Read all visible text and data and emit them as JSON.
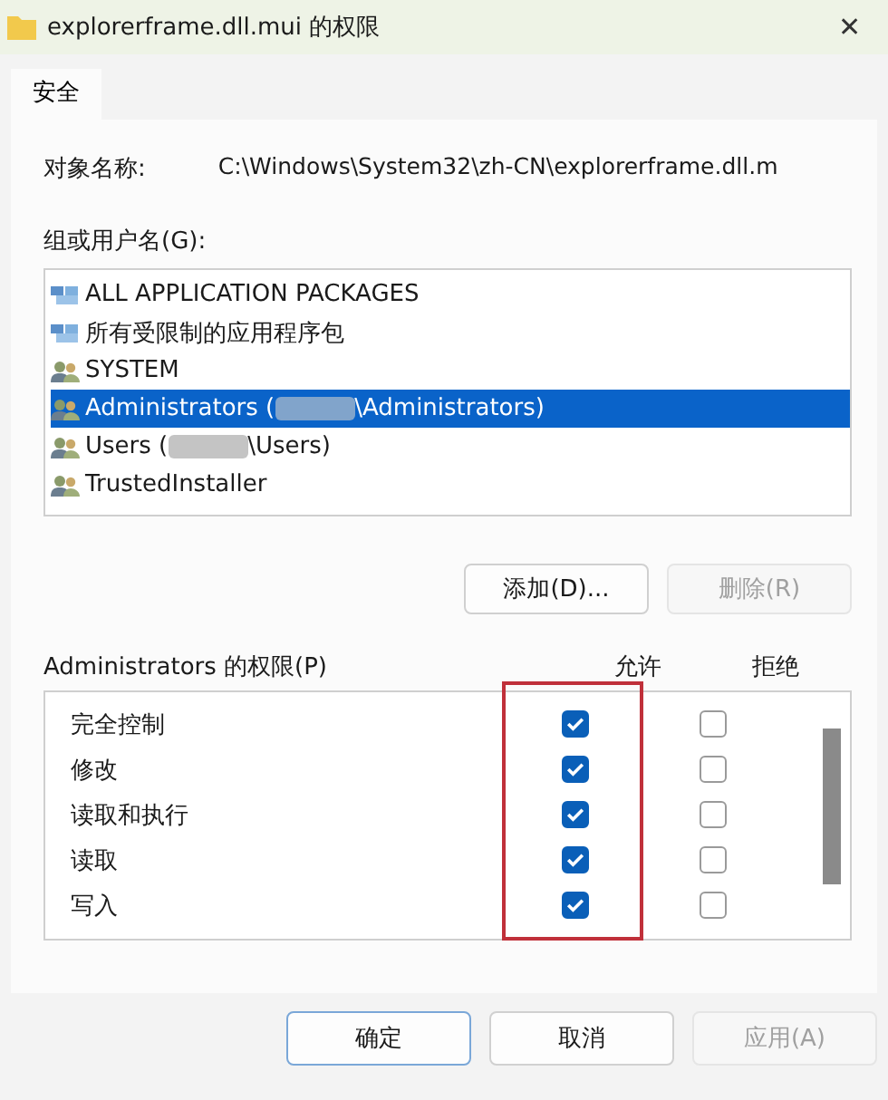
{
  "window": {
    "title": "explorerframe.dll.mui 的权限",
    "close": "✕"
  },
  "tabs": [
    {
      "label": "安全",
      "selected": true
    }
  ],
  "object_name": {
    "label": "对象名称:",
    "value": "C:\\Windows\\System32\\zh-CN\\explorerframe.dll.m"
  },
  "principals": {
    "label": "组或用户名(G):",
    "items": [
      {
        "kind": "package",
        "name": "ALL APPLICATION PACKAGES",
        "selected": false
      },
      {
        "kind": "package",
        "name": "所有受限制的应用程序包",
        "selected": false
      },
      {
        "kind": "user",
        "name": "SYSTEM",
        "selected": false
      },
      {
        "kind": "user",
        "name": "Administrators (",
        "redacted": true,
        "suffix": "\\Administrators)",
        "selected": true
      },
      {
        "kind": "user",
        "name": "Users (",
        "redacted": true,
        "suffix": "\\Users)",
        "selected": false
      },
      {
        "kind": "user",
        "name": "TrustedInstaller",
        "selected": false
      }
    ]
  },
  "principal_buttons": [
    {
      "label": "添加(D)...",
      "disabled": false
    },
    {
      "label": "删除(R)",
      "disabled": true
    }
  ],
  "permissions": {
    "label": "Administrators 的权限(P)",
    "allow_header": "允许",
    "deny_header": "拒绝",
    "highlight": true,
    "rows": [
      {
        "name": "完全控制",
        "allow": true,
        "deny": false
      },
      {
        "name": "修改",
        "allow": true,
        "deny": false
      },
      {
        "name": "读取和执行",
        "allow": true,
        "deny": false
      },
      {
        "name": "读取",
        "allow": true,
        "deny": false
      },
      {
        "name": "写入",
        "allow": true,
        "deny": false
      }
    ]
  },
  "buttons": [
    {
      "label": "确定",
      "kind": "default",
      "disabled": false
    },
    {
      "label": "取消",
      "kind": "normal",
      "disabled": false
    },
    {
      "label": "应用(A)",
      "kind": "normal",
      "disabled": true
    }
  ]
}
